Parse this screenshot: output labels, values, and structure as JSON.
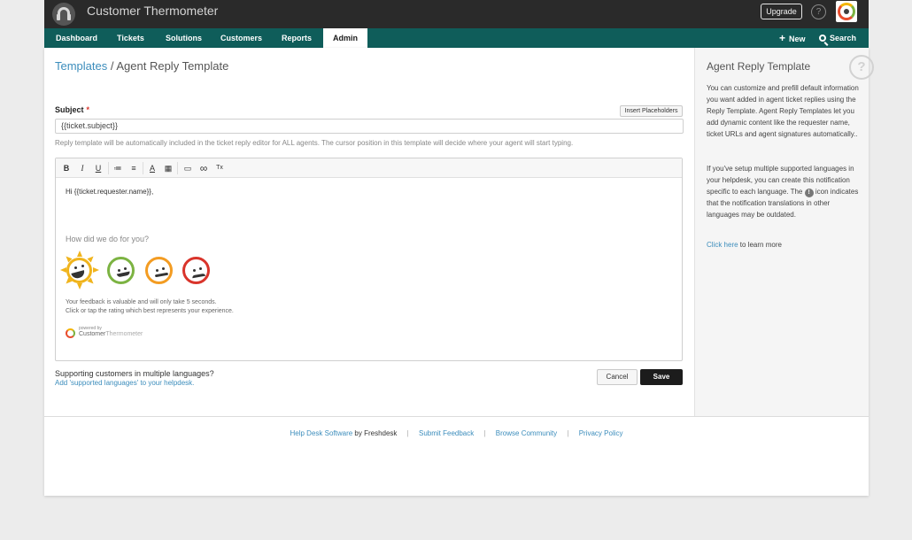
{
  "app": {
    "title": "Customer Thermometer",
    "upgrade_label": "Upgrade",
    "help_label": "?"
  },
  "nav": {
    "items": [
      "Dashboard",
      "Tickets",
      "Solutions",
      "Customers",
      "Reports",
      "Admin"
    ],
    "active": "Admin",
    "new_label": "New",
    "search_label": "Search"
  },
  "breadcrumb": {
    "parent": "Templates",
    "separator": " / ",
    "current": "Agent Reply Template"
  },
  "form": {
    "subject_label": "Subject",
    "required_mark": "*",
    "insert_placeholders": "Insert Placeholders",
    "subject_value": "{{ticket.subject}}",
    "hint": "Reply template will be automatically included in the ticket reply editor for ALL agents. The cursor position in this template will decide where your agent will start typing."
  },
  "toolbar": [
    "B",
    "I",
    "U",
    "≔",
    "≡",
    "A",
    "▦",
    "▭",
    "∞",
    "Tx"
  ],
  "editor": {
    "greeting": "Hi {{ticket.requester.name}},",
    "question": "How did we do for you?",
    "feedback_line1": "Your feedback is valuable and will only take 5 seconds.",
    "feedback_line2": "Click or tap the rating which best represents your experience.",
    "powered_by": "powered by",
    "powered_brand_a": "Customer",
    "powered_brand_b": "Thermometer",
    "rating_colors": [
      "#f0b41c",
      "#7cb342",
      "#f39c22",
      "#d9342b"
    ]
  },
  "multilang": {
    "question": "Supporting customers in multiple languages?",
    "link": "Add 'supported languages' to your helpdesk."
  },
  "actions": {
    "cancel": "Cancel",
    "save": "Save"
  },
  "sidebar": {
    "title": "Agent Reply Template",
    "help_label": "?",
    "paragraph1": "You can customize and prefill default information you want added in agent ticket replies using the Reply Template. Agent Reply Templates let you add dynamic content like the requester name, ticket URLs and agent signatures automatically..",
    "paragraph2_a": "If you've setup multiple supported languages in your helpdesk, you can create this notification specific to each language. The",
    "info_icon_label": "!",
    "paragraph2_b": "icon indicates that the notification translations in other languages may be outdated.",
    "learn_link": "Click here",
    "learn_rest": " to learn more"
  },
  "footer": {
    "link1": "Help Desk Software",
    "by_text": " by Freshdesk",
    "sep": "|",
    "link2": "Submit Feedback",
    "link3": "Browse Community",
    "link4": "Privacy Policy"
  }
}
